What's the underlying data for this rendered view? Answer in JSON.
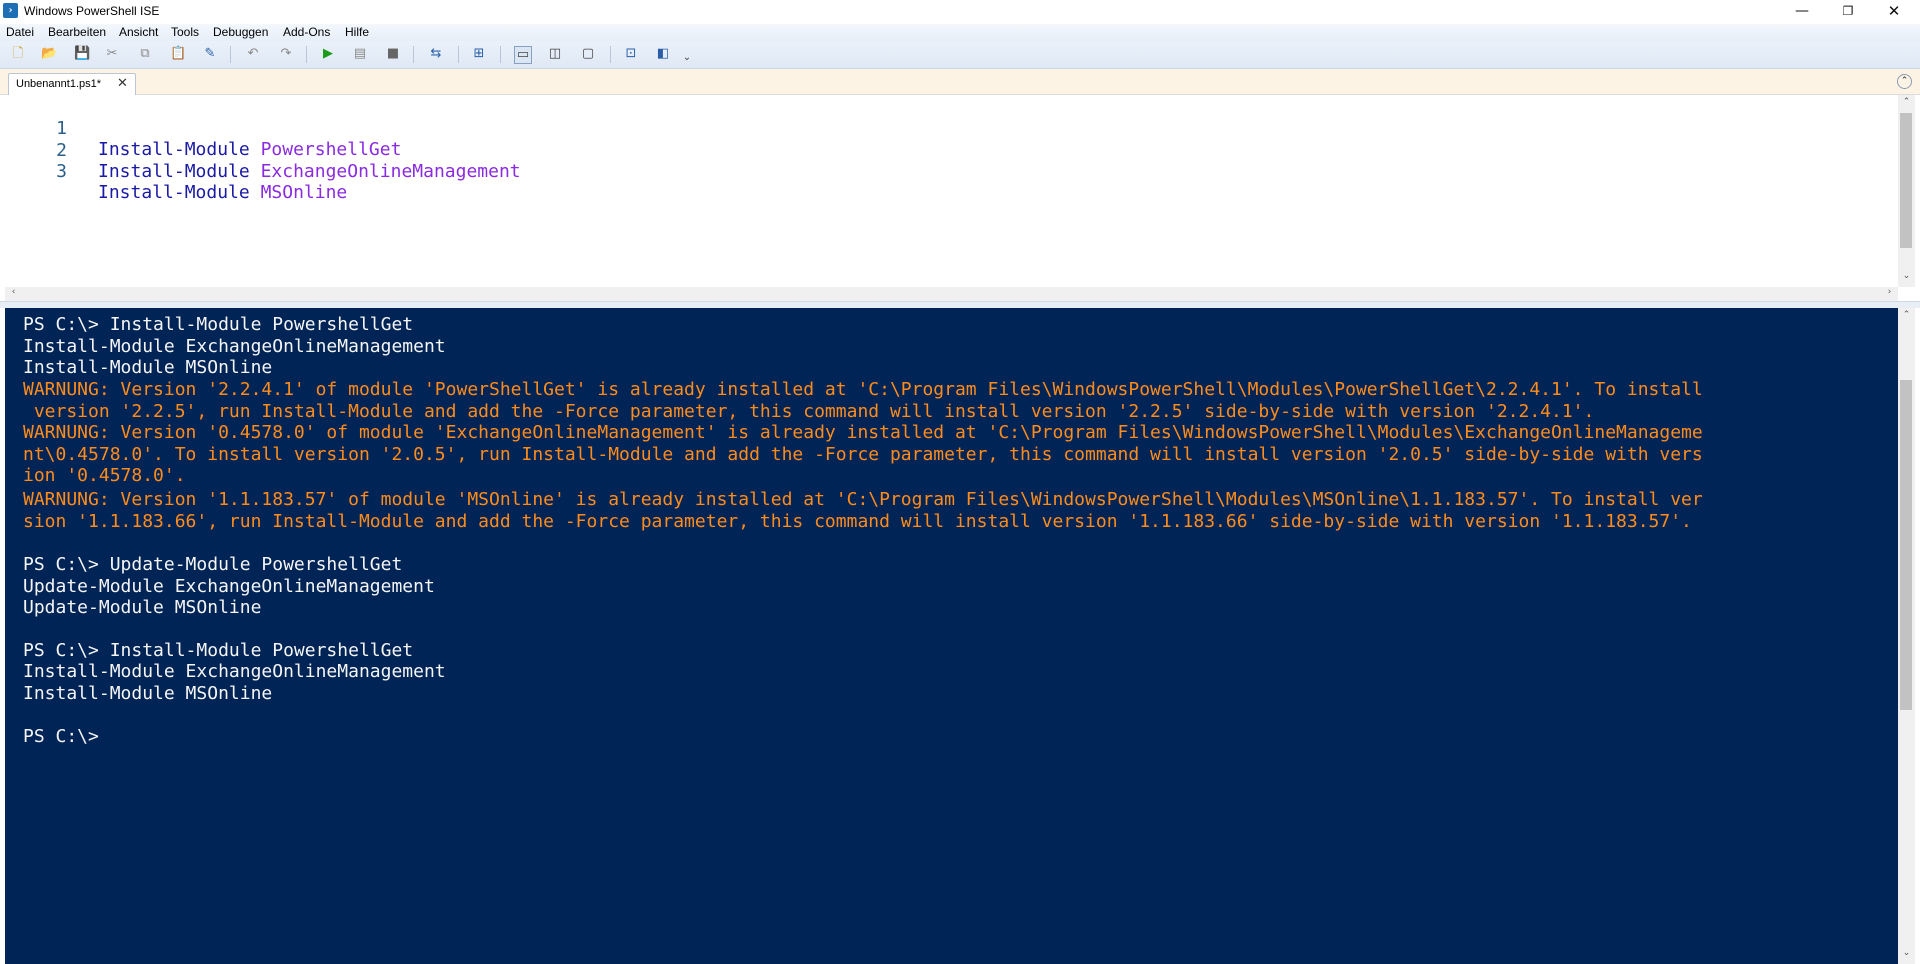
{
  "window": {
    "title": "Windows PowerShell ISE",
    "minimize_glyph": "—",
    "maximize_glyph": "❐",
    "close_glyph": "✕"
  },
  "menu": [
    "Datei",
    "Bearbeiten",
    "Ansicht",
    "Tools",
    "Debuggen",
    "Add-Ons",
    "Hilfe"
  ],
  "toolbar": {
    "icons": [
      {
        "name": "new-icon",
        "glyph": "🗋",
        "color": "#c9a227"
      },
      {
        "name": "open-icon",
        "glyph": "📂",
        "color": "#d8a531"
      },
      {
        "name": "save-icon",
        "glyph": "💾",
        "color": "#2a5fa8"
      },
      {
        "name": "cut-icon",
        "glyph": "✂",
        "color": "#8a8a8a"
      },
      {
        "name": "copy-icon",
        "glyph": "⧉",
        "color": "#8a8a8a"
      },
      {
        "name": "paste-icon",
        "glyph": "📋",
        "color": "#555555"
      },
      {
        "name": "clear-console-icon",
        "glyph": "✎",
        "color": "#2a5fa8"
      },
      {
        "name": "undo-icon",
        "glyph": "↶",
        "color": "#8a8a8a"
      },
      {
        "name": "redo-icon",
        "glyph": "↷",
        "color": "#8a8a8a"
      },
      {
        "name": "run-script-icon",
        "glyph": "▶",
        "color": "#1a9c1a"
      },
      {
        "name": "run-selection-icon",
        "glyph": "▤",
        "color": "#8a8a8a"
      },
      {
        "name": "stop-icon",
        "glyph": "■",
        "color": "#666666"
      },
      {
        "name": "remote-powershell-icon",
        "glyph": "⇆",
        "color": "#2a5fa8"
      },
      {
        "name": "start-powershell-icon",
        "glyph": "⊞",
        "color": "#2a5fa8"
      },
      {
        "name": "layout-top-icon",
        "glyph": "▭",
        "color": "#444444"
      },
      {
        "name": "layout-right-icon",
        "glyph": "◫",
        "color": "#444444"
      },
      {
        "name": "layout-max-icon",
        "glyph": "▢",
        "color": "#444444"
      },
      {
        "name": "show-commands-icon",
        "glyph": "⊡",
        "color": "#2a5fa8"
      },
      {
        "name": "show-addon-icon",
        "glyph": "◧",
        "color": "#2a5fa8"
      },
      {
        "name": "toolbar-overflow-icon",
        "glyph": "⌄",
        "color": "#444444"
      }
    ]
  },
  "tab": {
    "label": "Unbenannt1.ps1*",
    "close_glyph": "✕",
    "collapse_glyph": "⌃"
  },
  "editor": {
    "lines": [
      {
        "num": "1",
        "cmd": "Install-Module",
        "arg": "PowershellGet"
      },
      {
        "num": "2",
        "cmd": "Install-Module",
        "arg": "ExchangeOnlineManagement"
      },
      {
        "num": "3",
        "cmd": "Install-Module",
        "arg": "MSOnline"
      }
    ],
    "scroll_up": "⌃",
    "scroll_down": "⌄",
    "scroll_left": "‹",
    "scroll_right": "›"
  },
  "console": {
    "lines": [
      {
        "text": "PS C:\\> Install-Module PowershellGet",
        "warn": false
      },
      {
        "text": "Install-Module ExchangeOnlineManagement",
        "warn": false
      },
      {
        "text": "Install-Module MSOnline",
        "warn": false
      },
      {
        "text": "WARNUNG: Version '2.2.4.1' of module 'PowerShellGet' is already installed at 'C:\\Program Files\\WindowsPowerShell\\Modules\\PowerShellGet\\2.2.4.1'. To install",
        "warn": true
      },
      {
        "text": " version '2.2.5', run Install-Module and add the -Force parameter, this command will install version '2.2.5' side-by-side with version '2.2.4.1'.",
        "warn": true
      },
      {
        "text": "WARNUNG: Version '0.4578.0' of module 'ExchangeOnlineManagement' is already installed at 'C:\\Program Files\\WindowsPowerShell\\Modules\\ExchangeOnlineManageme",
        "warn": true
      },
      {
        "text": "nt\\0.4578.0'. To install version '2.0.5', run Install-Module and add the -Force parameter, this command will install version '2.0.5' side-by-side with vers",
        "warn": true
      },
      {
        "text": "ion '0.4578.0'.",
        "warn": true
      },
      {
        "text": "WARNUNG: Version '1.1.183.57' of module 'MSOnline' is already installed at 'C:\\Program Files\\WindowsPowerShell\\Modules\\MSOnline\\1.1.183.57'. To install ver",
        "warn": true
      },
      {
        "text": "sion '1.1.183.66', run Install-Module and add the -Force parameter, this command will install version '1.1.183.66' side-by-side with version '1.1.183.57'.",
        "warn": true
      },
      {
        "text": "",
        "warn": false
      },
      {
        "text": "PS C:\\> Update-Module PowershellGet",
        "warn": false
      },
      {
        "text": "Update-Module ExchangeOnlineManagement",
        "warn": false
      },
      {
        "text": "Update-Module MSOnline",
        "warn": false
      },
      {
        "text": "",
        "warn": false
      },
      {
        "text": "PS C:\\> Install-Module PowershellGet",
        "warn": false
      },
      {
        "text": "Install-Module ExchangeOnlineManagement",
        "warn": false
      },
      {
        "text": "Install-Module MSOnline",
        "warn": false
      },
      {
        "text": "",
        "warn": false
      },
      {
        "text": "PS C:\\>",
        "warn": false
      }
    ],
    "scroll_up": "⌃",
    "scroll_down": "⌄"
  },
  "colors": {
    "console_bg": "#012456",
    "console_text": "#f5f5f5",
    "warning_text": "#ff8c1a",
    "cmdlet": "#1a1aa6",
    "argument": "#8a2be2"
  }
}
